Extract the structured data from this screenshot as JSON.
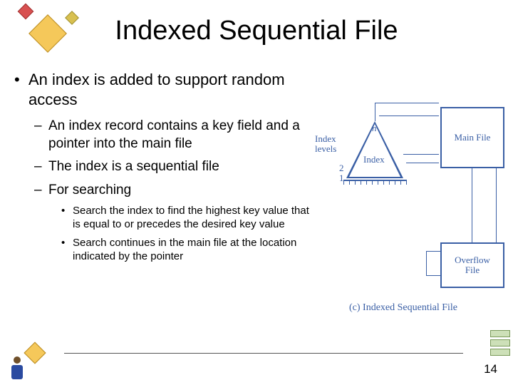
{
  "title": "Indexed Sequential File",
  "bullets": {
    "l1": "An index is added to support random access",
    "l2a": "An index record contains a key field and a pointer into the main file",
    "l2b": "The index is a sequential file",
    "l2c": "For searching",
    "l3a": "Search the index to find the highest key value that is equal to or precedes the desired key value",
    "l3b": "Search continues in the main file at the location indicated by the pointer"
  },
  "diagram": {
    "main_file": "Main File",
    "overflow": "Overflow\nFile",
    "index_label": "Index",
    "levels_label": "Index\nlevels",
    "n": "n",
    "two": "2",
    "one": "1",
    "caption": "(c) Indexed Sequential File"
  },
  "page_number": "14"
}
